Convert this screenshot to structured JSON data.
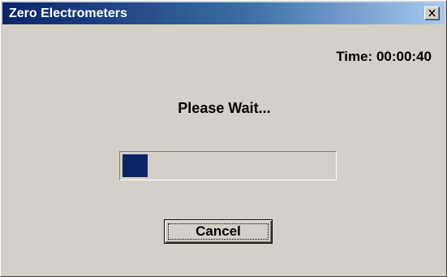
{
  "window": {
    "title": "Zero Electrometers"
  },
  "status": {
    "time_text": "Time: 00:00:40",
    "message": "Please Wait..."
  },
  "progress": {
    "percent": 12
  },
  "buttons": {
    "cancel_label": "Cancel"
  },
  "icons": {
    "close": "close-icon"
  },
  "colors": {
    "titlebar_start": "#0a246a",
    "titlebar_end": "#a6caf0",
    "dialog_background": "#d4d0c8",
    "progress_fill": "#0a246a"
  }
}
